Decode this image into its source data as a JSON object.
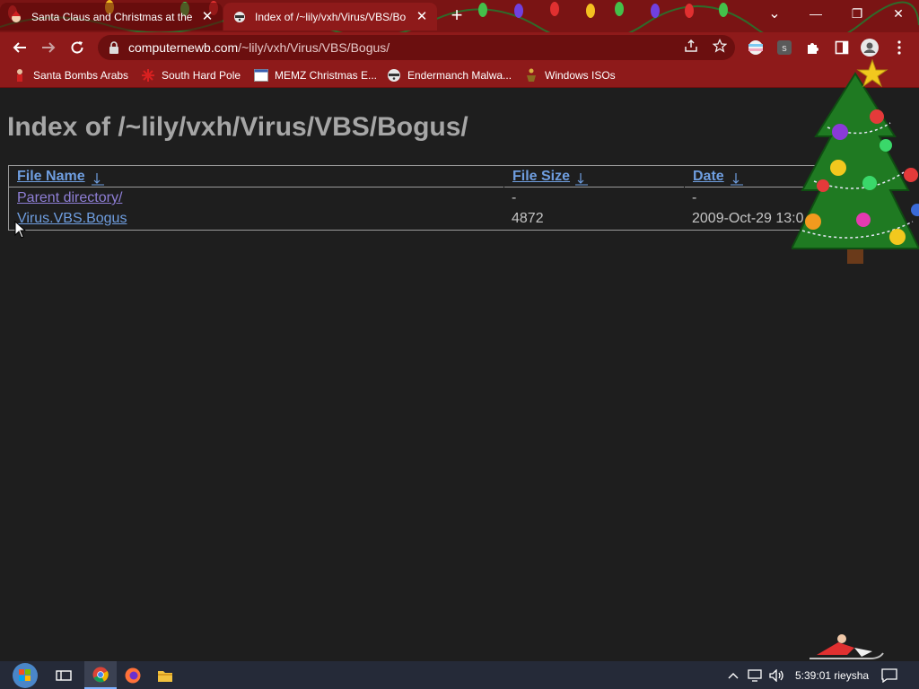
{
  "tabs": [
    {
      "title": "Santa Claus and Christmas at the",
      "close": "✕"
    },
    {
      "title": "Index of /~lily/vxh/Virus/VBS/Bo",
      "close": "✕"
    }
  ],
  "new_tab_label": "+",
  "window_controls": {
    "menu": "⌄",
    "minimize": "—",
    "restore": "❐",
    "close": "✕"
  },
  "address": {
    "host": "computernewb.com",
    "path": "/~lily/vxh/Virus/VBS/Bogus/"
  },
  "bookmarks": [
    {
      "label": "Santa Bombs Arabs",
      "icon": "santa-icon"
    },
    {
      "label": "South Hard Pole",
      "icon": "snowflake-icon"
    },
    {
      "label": "MEMZ Christmas E...",
      "icon": "window-icon"
    },
    {
      "label": "Endermanch Malwa...",
      "icon": "raccoon-icon"
    },
    {
      "label": "Windows ISOs",
      "icon": "figure-icon"
    }
  ],
  "page": {
    "title": "Index of /~lily/vxh/Virus/VBS/Bogus/",
    "columns": [
      "File Name",
      "File Size",
      "Date"
    ],
    "rows": [
      {
        "name": "Parent directory/",
        "size": "-",
        "date": "-"
      },
      {
        "name": "Virus.VBS.Bogus",
        "size": "4872",
        "date": "2009-Oct-29 13:0"
      }
    ]
  },
  "ext_badge": "s",
  "taskbar": {
    "clock": "5:39:01 rieysha"
  },
  "colors": {
    "tab_strip": "#7a1414",
    "toolbar": "#8e1a1a",
    "page_bg": "#1e1e1e",
    "link": "#6f9ee0",
    "visited_link": "#8f7fd6",
    "taskbar": "#252a38"
  }
}
